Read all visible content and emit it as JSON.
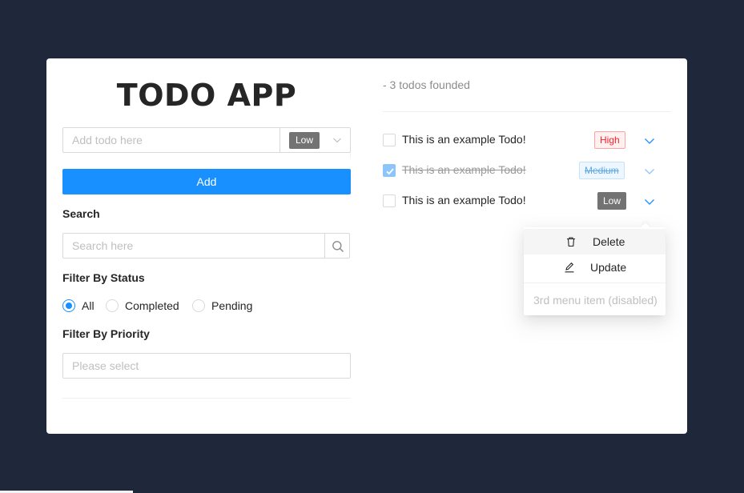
{
  "app": {
    "title": "TODO APP"
  },
  "add_form": {
    "placeholder": "Add todo here",
    "priority_value": "Low",
    "button_label": "Add"
  },
  "search": {
    "label": "Search",
    "placeholder": "Search here"
  },
  "status_filter": {
    "label": "Filter By Status",
    "options": [
      "All",
      "Completed",
      "Pending"
    ],
    "selected": "All"
  },
  "priority_filter": {
    "label": "Filter By Priority",
    "placeholder": "Please select"
  },
  "todo_list": {
    "count_text": "- 3 todos founded",
    "items": [
      {
        "text": "This is an example Todo!",
        "priority": "High",
        "completed": false
      },
      {
        "text": "This is an example Todo!",
        "priority": "Medium",
        "completed": true
      },
      {
        "text": "This is an example Todo!",
        "priority": "Low",
        "completed": false
      }
    ]
  },
  "context_menu": {
    "items": [
      {
        "label": "Delete",
        "icon": "trash-icon"
      },
      {
        "label": "Update",
        "icon": "edit-icon"
      },
      {
        "label": "3rd menu item (disabled)",
        "disabled": true
      }
    ]
  },
  "colors": {
    "background": "#1f283b",
    "primary": "#1890ff",
    "high": "#f5222d",
    "low": "#737373"
  }
}
